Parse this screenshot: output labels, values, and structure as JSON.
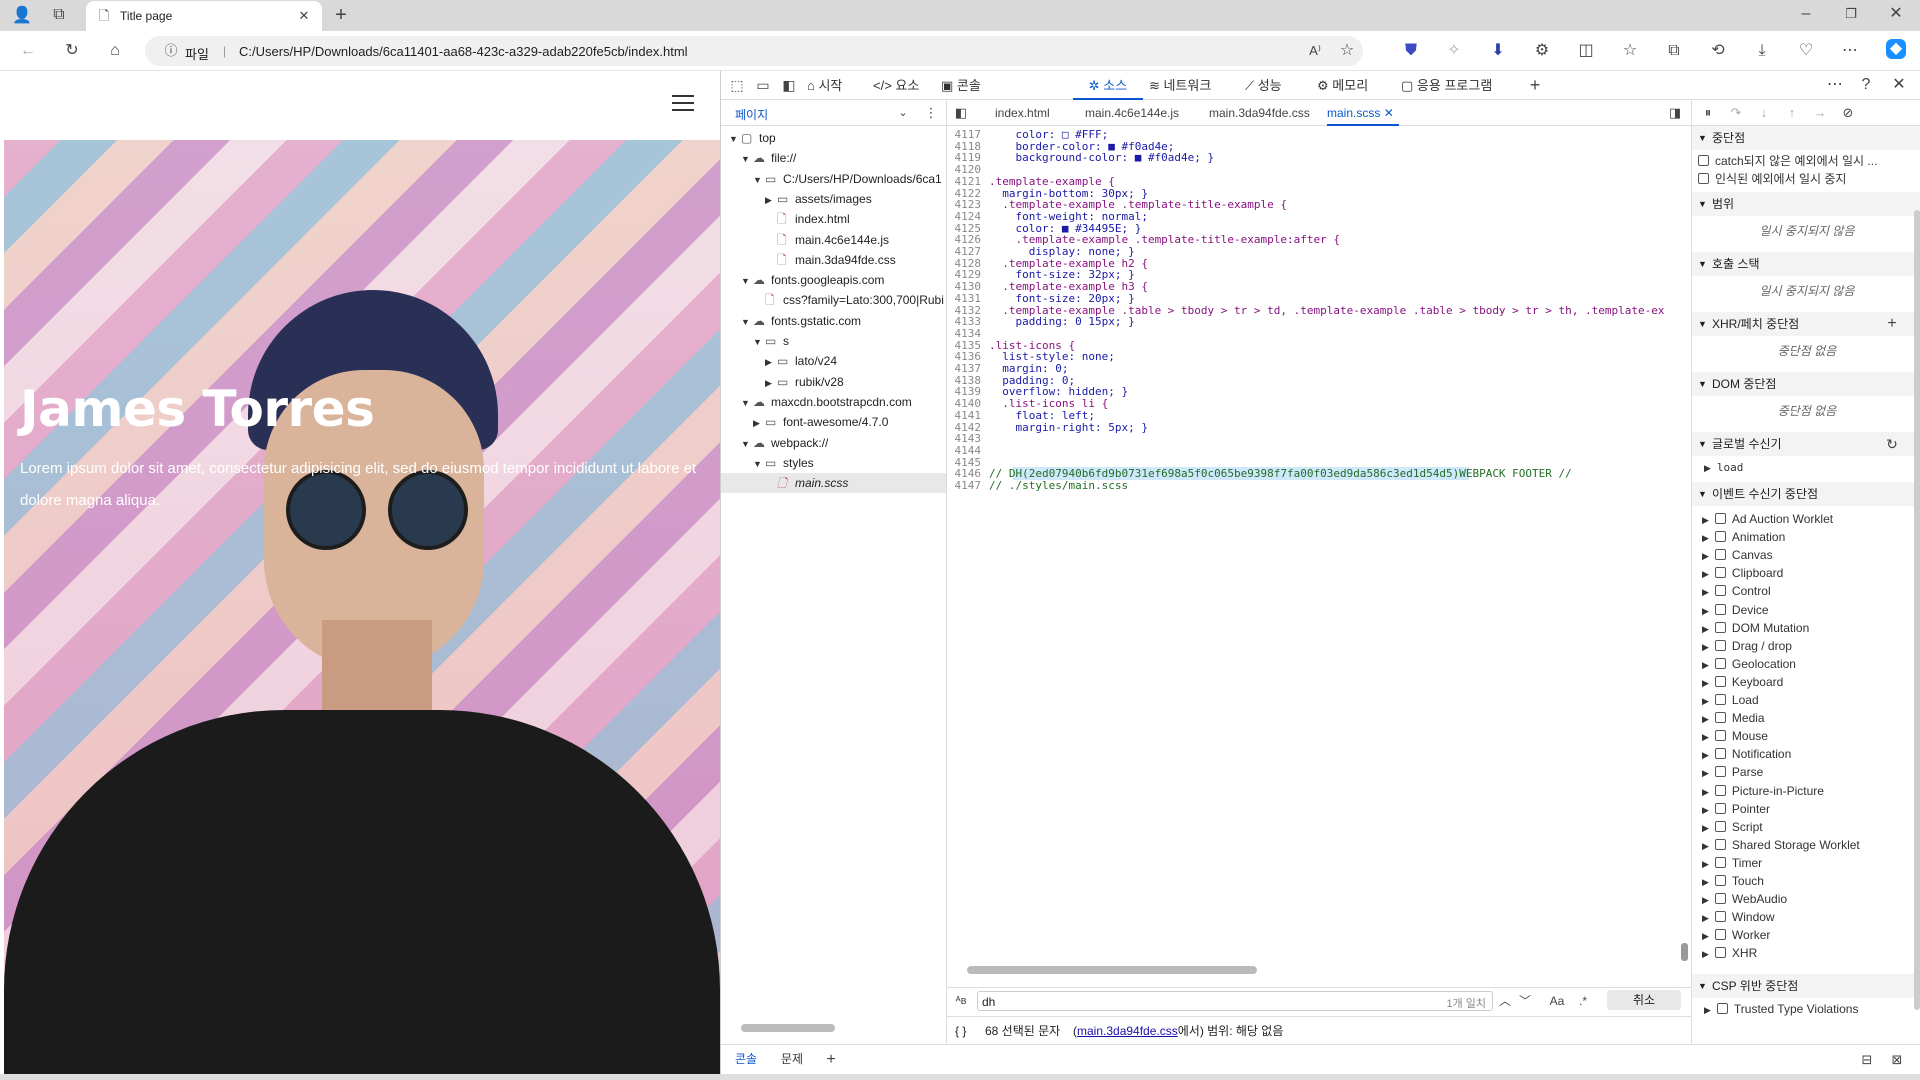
{
  "browser": {
    "tab_title": "Title page",
    "url_prefix": "파일",
    "url": "C:/Users/HP/Downloads/6ca11401-aa68-423c-a329-adab220fe5cb/index.html"
  },
  "page": {
    "hero_title": "James Torres",
    "hero_text": "Lorem ipsum dolor sit amet, consectetur adipisicing elit, sed do eiusmod tempor incididunt ut labore et dolore magna aliqua."
  },
  "devtools": {
    "tabs": [
      "시작",
      "요소",
      "콘솔",
      "소스",
      "네트워크",
      "성능",
      "메모리",
      "응용 프로그램"
    ],
    "active_tab": "소스",
    "navigator_label": "페이지",
    "tree": [
      {
        "label": "top",
        "depth": 0,
        "arrow": "▼",
        "icon": "frame"
      },
      {
        "label": "file://",
        "depth": 1,
        "arrow": "▼",
        "icon": "cloud"
      },
      {
        "label": "C:/Users/HP/Downloads/6ca1",
        "depth": 2,
        "arrow": "▼",
        "icon": "folder"
      },
      {
        "label": "assets/images",
        "depth": 3,
        "arrow": "▶",
        "icon": "folder"
      },
      {
        "label": "index.html",
        "depth": 3,
        "arrow": "",
        "icon": "file"
      },
      {
        "label": "main.4c6e144e.js",
        "depth": 3,
        "arrow": "",
        "icon": "file"
      },
      {
        "label": "main.3da94fde.css",
        "depth": 3,
        "arrow": "",
        "icon": "file"
      },
      {
        "label": "fonts.googleapis.com",
        "depth": 1,
        "arrow": "▼",
        "icon": "cloud"
      },
      {
        "label": "css?family=Lato:300,700|Rubi",
        "depth": 2,
        "arrow": "",
        "icon": "file"
      },
      {
        "label": "fonts.gstatic.com",
        "depth": 1,
        "arrow": "▼",
        "icon": "cloud"
      },
      {
        "label": "s",
        "depth": 2,
        "arrow": "▼",
        "icon": "folder"
      },
      {
        "label": "lato/v24",
        "depth": 3,
        "arrow": "▶",
        "icon": "folder"
      },
      {
        "label": "rubik/v28",
        "depth": 3,
        "arrow": "▶",
        "icon": "folder"
      },
      {
        "label": "maxcdn.bootstrapcdn.com",
        "depth": 1,
        "arrow": "▼",
        "icon": "cloud"
      },
      {
        "label": "font-awesome/4.7.0",
        "depth": 2,
        "arrow": "▶",
        "icon": "folder"
      },
      {
        "label": "webpack://",
        "depth": 1,
        "arrow": "▼",
        "icon": "cloud"
      },
      {
        "label": "styles",
        "depth": 2,
        "arrow": "▼",
        "icon": "folder"
      },
      {
        "label": "main.scss",
        "depth": 3,
        "arrow": "",
        "icon": "file"
      }
    ],
    "file_tabs": [
      "index.html",
      "main.4c6e144e.js",
      "main.3da94fde.css",
      "main.scss"
    ],
    "active_file": "main.scss",
    "code_lines": [
      {
        "n": "4117",
        "t": "    color: □ #FFF;"
      },
      {
        "n": "4118",
        "t": "    border-color: ■ #f0ad4e;"
      },
      {
        "n": "4119",
        "t": "    background-color: ■ #f0ad4e; }"
      },
      {
        "n": "4120",
        "t": ""
      },
      {
        "n": "4121",
        "t": ".template-example {"
      },
      {
        "n": "4122",
        "t": "  margin-bottom: 30px; }"
      },
      {
        "n": "4123",
        "t": "  .template-example .template-title-example {"
      },
      {
        "n": "4124",
        "t": "    font-weight: normal;"
      },
      {
        "n": "4125",
        "t": "    color: ■ #34495E; }"
      },
      {
        "n": "4126",
        "t": "    .template-example .template-title-example:after {"
      },
      {
        "n": "4127",
        "t": "      display: none; }"
      },
      {
        "n": "4128",
        "t": "  .template-example h2 {"
      },
      {
        "n": "4129",
        "t": "    font-size: 32px; }"
      },
      {
        "n": "4130",
        "t": "  .template-example h3 {"
      },
      {
        "n": "4131",
        "t": "    font-size: 20px; }"
      },
      {
        "n": "4132",
        "t": "  .template-example .table > tbody > tr > td, .template-example .table > tbody > tr > th, .template-ex"
      },
      {
        "n": "4133",
        "t": "    padding: 0 15px; }"
      },
      {
        "n": "4134",
        "t": ""
      },
      {
        "n": "4135",
        "t": ".list-icons {"
      },
      {
        "n": "4136",
        "t": "  list-style: none;"
      },
      {
        "n": "4137",
        "t": "  margin: 0;"
      },
      {
        "n": "4138",
        "t": "  padding: 0;"
      },
      {
        "n": "4139",
        "t": "  overflow: hidden; }"
      },
      {
        "n": "4140",
        "t": "  .list-icons li {"
      },
      {
        "n": "4141",
        "t": "    float: left;"
      },
      {
        "n": "4142",
        "t": "    margin-right: 5px; }"
      },
      {
        "n": "4143",
        "t": ""
      },
      {
        "n": "4144",
        "t": ""
      },
      {
        "n": "4145",
        "t": ""
      },
      {
        "n": "4146",
        "t": "// DH(2ed07940b6fd9b0731ef698a5f0c065be9398f7fa00f03ed9da586c3ed1d54d5)WEBPACK FOOTER //"
      },
      {
        "n": "4147",
        "t": "// ./styles/main.scss"
      }
    ],
    "search_value": "dh",
    "search_count": "1개 일치",
    "search_cancel": "취소",
    "status_text": "68 선택된 문자",
    "status_link": "main.3da94fde.css",
    "status_suffix": "에서)  범위: 해당 없음",
    "drawer_tabs": [
      "콘솔",
      "문제"
    ],
    "sidebar": {
      "breakpoints": "중단점",
      "pause_caught": "catch되지 않은 예외에서 일시 ...",
      "pause_uncaught": "인식된 예외에서 일시 중지",
      "scope": "범위",
      "scope_empty": "일시 중지되지 않음",
      "callstack": "호출 스택",
      "callstack_empty": "일시 중지되지 않음",
      "xhr": "XHR/페치 중단점",
      "xhr_empty": "중단점 없음",
      "dom": "DOM 중단점",
      "dom_empty": "중단점 없음",
      "global": "글로벌 수신기",
      "global_item": "load",
      "event": "이벤트 수신기 중단점",
      "events": [
        "Ad Auction Worklet",
        "Animation",
        "Canvas",
        "Clipboard",
        "Control",
        "Device",
        "DOM Mutation",
        "Drag / drop",
        "Geolocation",
        "Keyboard",
        "Load",
        "Media",
        "Mouse",
        "Notification",
        "Parse",
        "Picture-in-Picture",
        "Pointer",
        "Script",
        "Shared Storage Worklet",
        "Timer",
        "Touch",
        "WebAudio",
        "Window",
        "Worker",
        "XHR"
      ],
      "csp": "CSP 위반 중단점",
      "csp_item": "Trusted Type Violations"
    }
  }
}
